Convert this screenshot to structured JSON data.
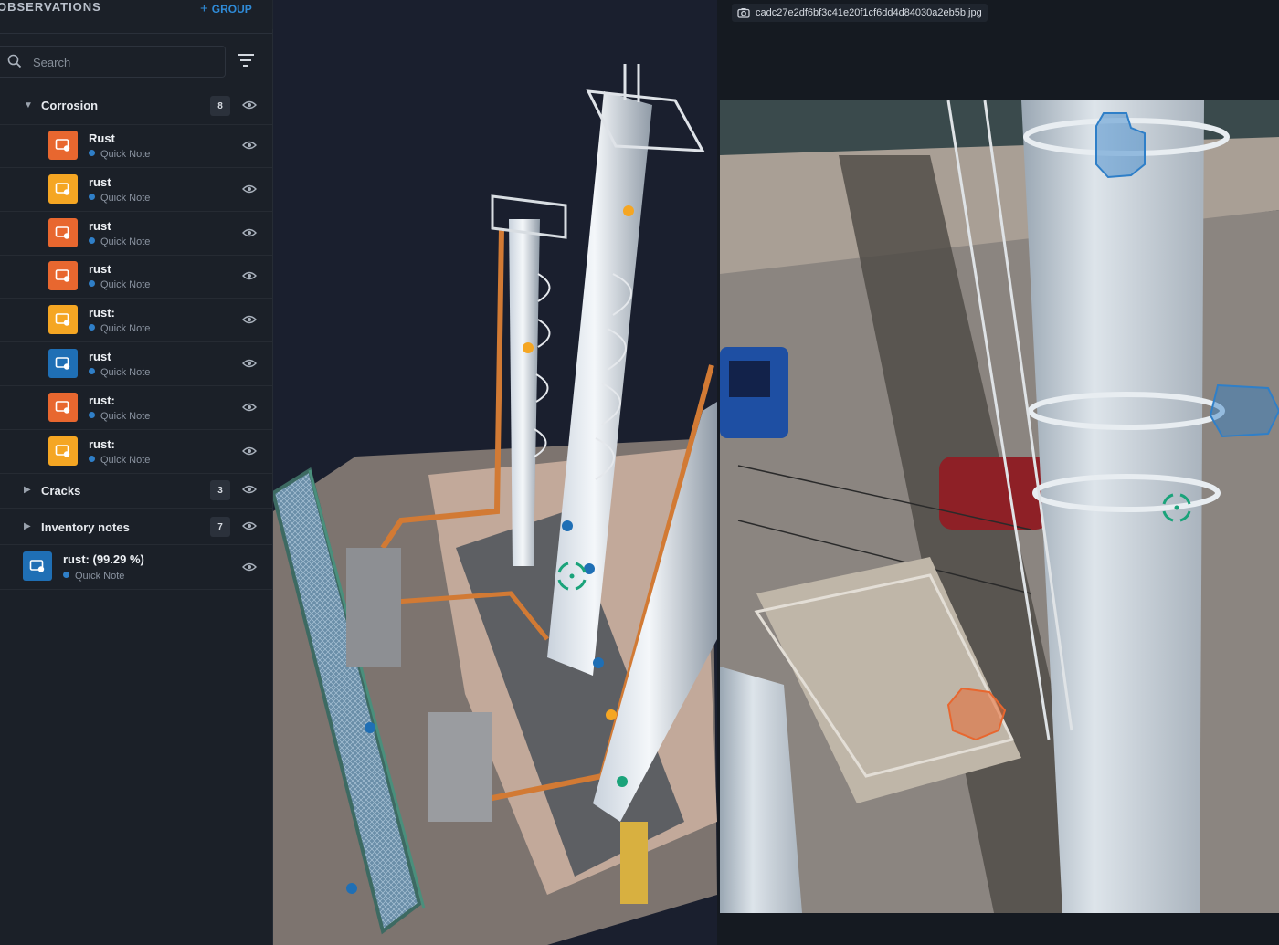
{
  "sidebar": {
    "title": "OBSERVATIONS",
    "add_group_label": "GROUP",
    "search_placeholder": "Search",
    "groups": [
      {
        "label": "Corrosion",
        "count": "8",
        "expanded": true,
        "items": [
          {
            "title": "Rust",
            "subtitle": "Quick Note",
            "color": "#e8672f"
          },
          {
            "title": "rust",
            "subtitle": "Quick Note",
            "color": "#f5a623"
          },
          {
            "title": "rust",
            "subtitle": "Quick Note",
            "color": "#e8672f"
          },
          {
            "title": "rust",
            "subtitle": "Quick Note",
            "color": "#e8672f"
          },
          {
            "title": "rust:",
            "subtitle": "Quick Note",
            "color": "#f5a623"
          },
          {
            "title": "rust",
            "subtitle": "Quick Note",
            "color": "#1f6fb5"
          },
          {
            "title": "rust:",
            "subtitle": "Quick Note",
            "color": "#e8672f"
          },
          {
            "title": "rust:",
            "subtitle": "Quick Note",
            "color": "#f5a623"
          }
        ]
      },
      {
        "label": "Cracks",
        "count": "3",
        "expanded": false
      },
      {
        "label": "Inventory notes",
        "count": "7",
        "expanded": false
      }
    ],
    "ungrouped": [
      {
        "title": "rust: (99.29 %)",
        "subtitle": "Quick Note",
        "color": "#1f6fb5"
      }
    ]
  },
  "photo": {
    "filename": "cadc27e2df6bf3c41e20f1cf6dd4d84030a2eb5b.jpg"
  },
  "icons": {
    "collapse": "chevron-left-icon",
    "search": "search-icon",
    "filter": "filter-icon",
    "visibility": "eye-icon",
    "observation": "observation-note-icon",
    "camera": "camera-icon"
  },
  "colors": {
    "accent": "#2f8bd8",
    "orange_marker": "#e8672f",
    "amber_marker": "#f5a623",
    "blue_marker": "#1f6fb5",
    "green_marker": "#1aa37a"
  }
}
